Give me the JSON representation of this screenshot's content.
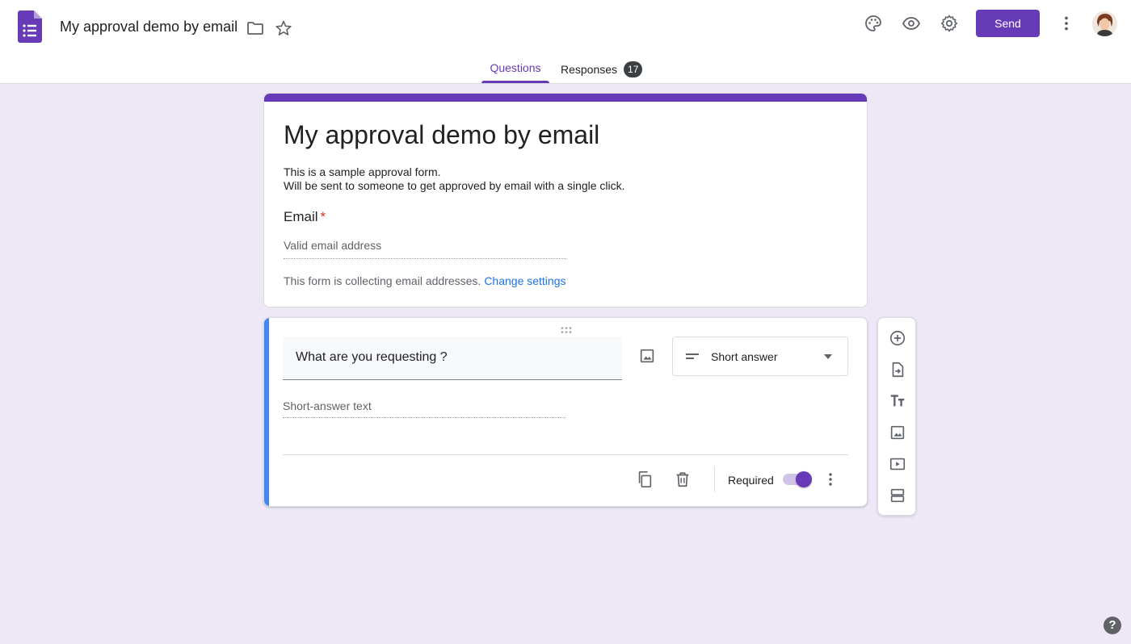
{
  "header": {
    "title": "My approval demo by email",
    "send_label": "Send",
    "icons": [
      "palette-icon",
      "eye-icon",
      "gear-icon",
      "more-vert-icon"
    ],
    "accent_color": "#673ab7"
  },
  "tabs": {
    "questions": "Questions",
    "responses": "Responses",
    "responses_count": "17"
  },
  "form": {
    "title": "My approval demo by email",
    "description_line1": "This is a sample approval form.",
    "description_line2": "Will be sent to someone to get approved by email with a single click.",
    "email_label": "Email",
    "required_mark": "*",
    "email_placeholder": "Valid email address",
    "collect_note": "This form is collecting email addresses.",
    "change_settings": "Change settings"
  },
  "question": {
    "title": "What are you requesting ?",
    "type": "Short answer",
    "answer_placeholder": "Short-answer text",
    "required_label": "Required",
    "required_on": true
  },
  "toolbar": {
    "tools": [
      "add-question-icon",
      "import-questions-icon",
      "add-title-icon",
      "add-image-icon",
      "add-video-icon",
      "add-section-icon"
    ]
  },
  "help": "?"
}
